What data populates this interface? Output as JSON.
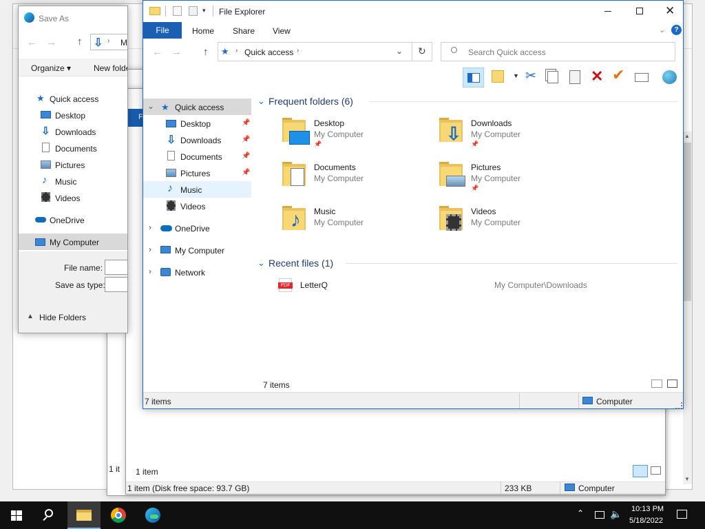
{
  "desktop_bg": "#f0f0f0",
  "save_as": {
    "title": "Save As",
    "address": "My Co",
    "organize": "Organize ▾",
    "new_folder": "New folder",
    "nav": [
      {
        "label": "Quick access"
      },
      {
        "label": "Desktop"
      },
      {
        "label": "Downloads"
      },
      {
        "label": "Documents"
      },
      {
        "label": "Pictures"
      },
      {
        "label": "Music"
      },
      {
        "label": "Videos"
      },
      {
        "label": "OneDrive"
      },
      {
        "label": "My Computer"
      }
    ],
    "file_name_label": "File name:",
    "save_type_label": "Save as type:",
    "hide_folders": "Hide Folders"
  },
  "bg_explorer": {
    "status_items": "1 item",
    "status_bar": "1 item (Disk free space: 93.7 GB)",
    "size": "233 KB",
    "location": "Computer",
    "left_status": "1 it"
  },
  "explorer": {
    "title": "File Explorer",
    "ribbon_tabs": [
      "File",
      "Home",
      "Share",
      "View"
    ],
    "breadcrumb": "Quick access",
    "search_placeholder": "Search Quick access",
    "nav": {
      "quick_access": "Quick access",
      "desktop": "Desktop",
      "downloads": "Downloads",
      "documents": "Documents",
      "pictures": "Pictures",
      "music": "Music",
      "videos": "Videos",
      "onedrive": "OneDrive",
      "my_computer": "My Computer",
      "network": "Network"
    },
    "frequent_header": "Frequent folders (6)",
    "folders": [
      {
        "name": "Desktop",
        "location": "My Computer"
      },
      {
        "name": "Downloads",
        "location": "My Computer"
      },
      {
        "name": "Documents",
        "location": "My Computer"
      },
      {
        "name": "Pictures",
        "location": "My Computer"
      },
      {
        "name": "Music",
        "location": "My Computer"
      },
      {
        "name": "Videos",
        "location": "My Computer"
      }
    ],
    "recent_header": "Recent files (1)",
    "recent": [
      {
        "name": "LetterQ",
        "path": "My Computer\\Downloads",
        "badge": "PDF"
      }
    ],
    "content_status": "7 items",
    "status_items": "7 items",
    "status_location": "Computer"
  },
  "taskbar": {
    "time": "10:13 PM",
    "date": "5/18/2022"
  },
  "colors": {
    "accent": "#1b6ac9",
    "file_tab": "#1a5fb4",
    "selected": "#cce8ff",
    "hover": "#e5f3ff",
    "taskbar": "#101010"
  }
}
